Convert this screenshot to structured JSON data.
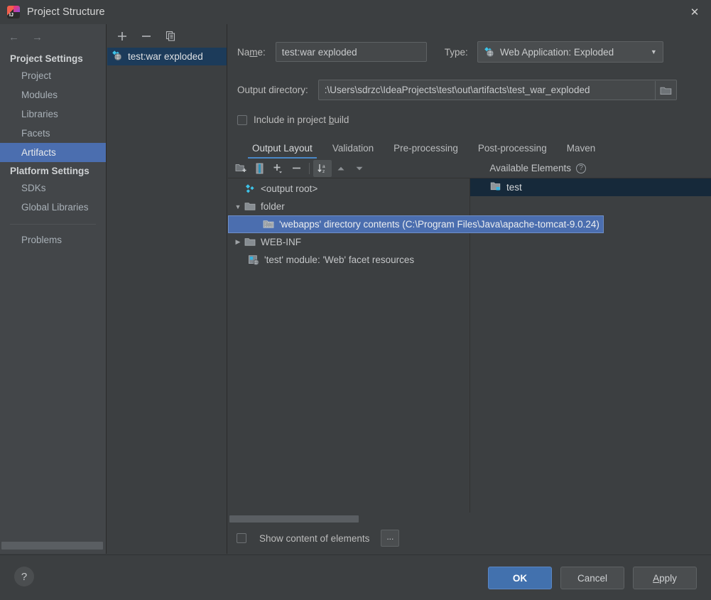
{
  "window": {
    "title": "Project Structure",
    "app_icon": "intellij-idea-logo",
    "close_icon": "✕"
  },
  "sidebar": {
    "back_icon": "←",
    "forward_icon": "→",
    "groups": [
      {
        "label": "Project Settings",
        "items": [
          {
            "label": "Project",
            "selected": false
          },
          {
            "label": "Modules",
            "selected": false
          },
          {
            "label": "Libraries",
            "selected": false
          },
          {
            "label": "Facets",
            "selected": false
          },
          {
            "label": "Artifacts",
            "selected": true
          }
        ]
      },
      {
        "label": "Platform Settings",
        "items": [
          {
            "label": "SDKs",
            "selected": false
          },
          {
            "label": "Global Libraries",
            "selected": false
          }
        ]
      }
    ],
    "extra_items": [
      {
        "label": "Problems",
        "selected": false
      }
    ]
  },
  "artifact_panel": {
    "toolbar": [
      {
        "name": "add-artifact-button",
        "glyph": "+"
      },
      {
        "name": "remove-artifact-button",
        "glyph": "−"
      },
      {
        "name": "copy-artifact-button",
        "glyph": "copy-icon"
      }
    ],
    "items": [
      {
        "label": "test:war exploded",
        "icon": "web-artifact-icon",
        "selected": true
      }
    ]
  },
  "main": {
    "name_label": "Name:",
    "name_label_mnemonic": "m",
    "name_value": "test:war exploded",
    "type_label": "Type:",
    "type_value": "Web Application: Exploded",
    "type_icon": "web-artifact-icon",
    "type_arrow": "▼",
    "output_dir_label": "Output directory:",
    "output_dir_value": ":\\Users\\sdrzc\\IdeaProjects\\test\\out\\artifacts\\test_war_exploded",
    "browse_icon": "folder-icon",
    "include_in_build_label": "Include in project build",
    "include_in_build_checked": false,
    "tabs": [
      {
        "label": "Output Layout",
        "active": true
      },
      {
        "label": "Validation",
        "active": false
      },
      {
        "label": "Pre-processing",
        "active": false
      },
      {
        "label": "Post-processing",
        "active": false
      },
      {
        "label": "Maven",
        "active": false
      }
    ],
    "layout_toolbar": [
      {
        "name": "add-directory-icon",
        "active": false
      },
      {
        "name": "add-archive-icon",
        "active": false
      },
      {
        "name": "add-element-dropdown-icon",
        "active": false
      },
      {
        "name": "remove-element-icon",
        "active": false
      },
      {
        "name": "sort-alphabetically-icon",
        "active": true
      },
      {
        "name": "move-up-icon",
        "active": false
      },
      {
        "name": "move-down-icon",
        "active": false
      }
    ],
    "available_elements_label": "Available Elements",
    "available_elements_help": "?",
    "output_tree": [
      {
        "label": "<output root>",
        "icon": "artifact-root-icon",
        "indent": 0,
        "twisty": "",
        "selected": false
      },
      {
        "label": "folder",
        "icon": "folder-icon",
        "indent": 0,
        "twisty": "▼",
        "selected": false
      },
      {
        "label": "'webapps' directory contents (C:\\Program Files\\Java\\apache-tomcat-9.0.24)",
        "icon": "directory-contents-icon",
        "indent": 1,
        "twisty": "",
        "selected": true
      },
      {
        "label": "WEB-INF",
        "icon": "folder-icon",
        "indent": 0,
        "twisty": "▶",
        "selected": false
      },
      {
        "label": "'test' module: 'Web' facet resources",
        "icon": "web-facet-icon",
        "indent": 1,
        "twisty": "",
        "selected": false
      }
    ],
    "available_elements": [
      {
        "label": "test",
        "icon": "module-folder-icon",
        "selected": true
      }
    ],
    "show_content_label": "Show content of elements",
    "show_content_checked": false,
    "more_button_label": "..."
  },
  "footer": {
    "help_label": "?",
    "buttons": [
      {
        "label": "OK",
        "primary": true,
        "mnemonic": ""
      },
      {
        "label": "Cancel",
        "primary": false,
        "mnemonic": ""
      },
      {
        "label": "Apply",
        "primary": false,
        "mnemonic": "A"
      }
    ]
  },
  "colors": {
    "window_bg": "#3c3f41",
    "sidebar_bg": "#434649",
    "selection_blue": "#4b6eaf",
    "accent_blue": "#4a88c7",
    "primary_button": "#4271ae",
    "dark_row": "#16293a"
  }
}
